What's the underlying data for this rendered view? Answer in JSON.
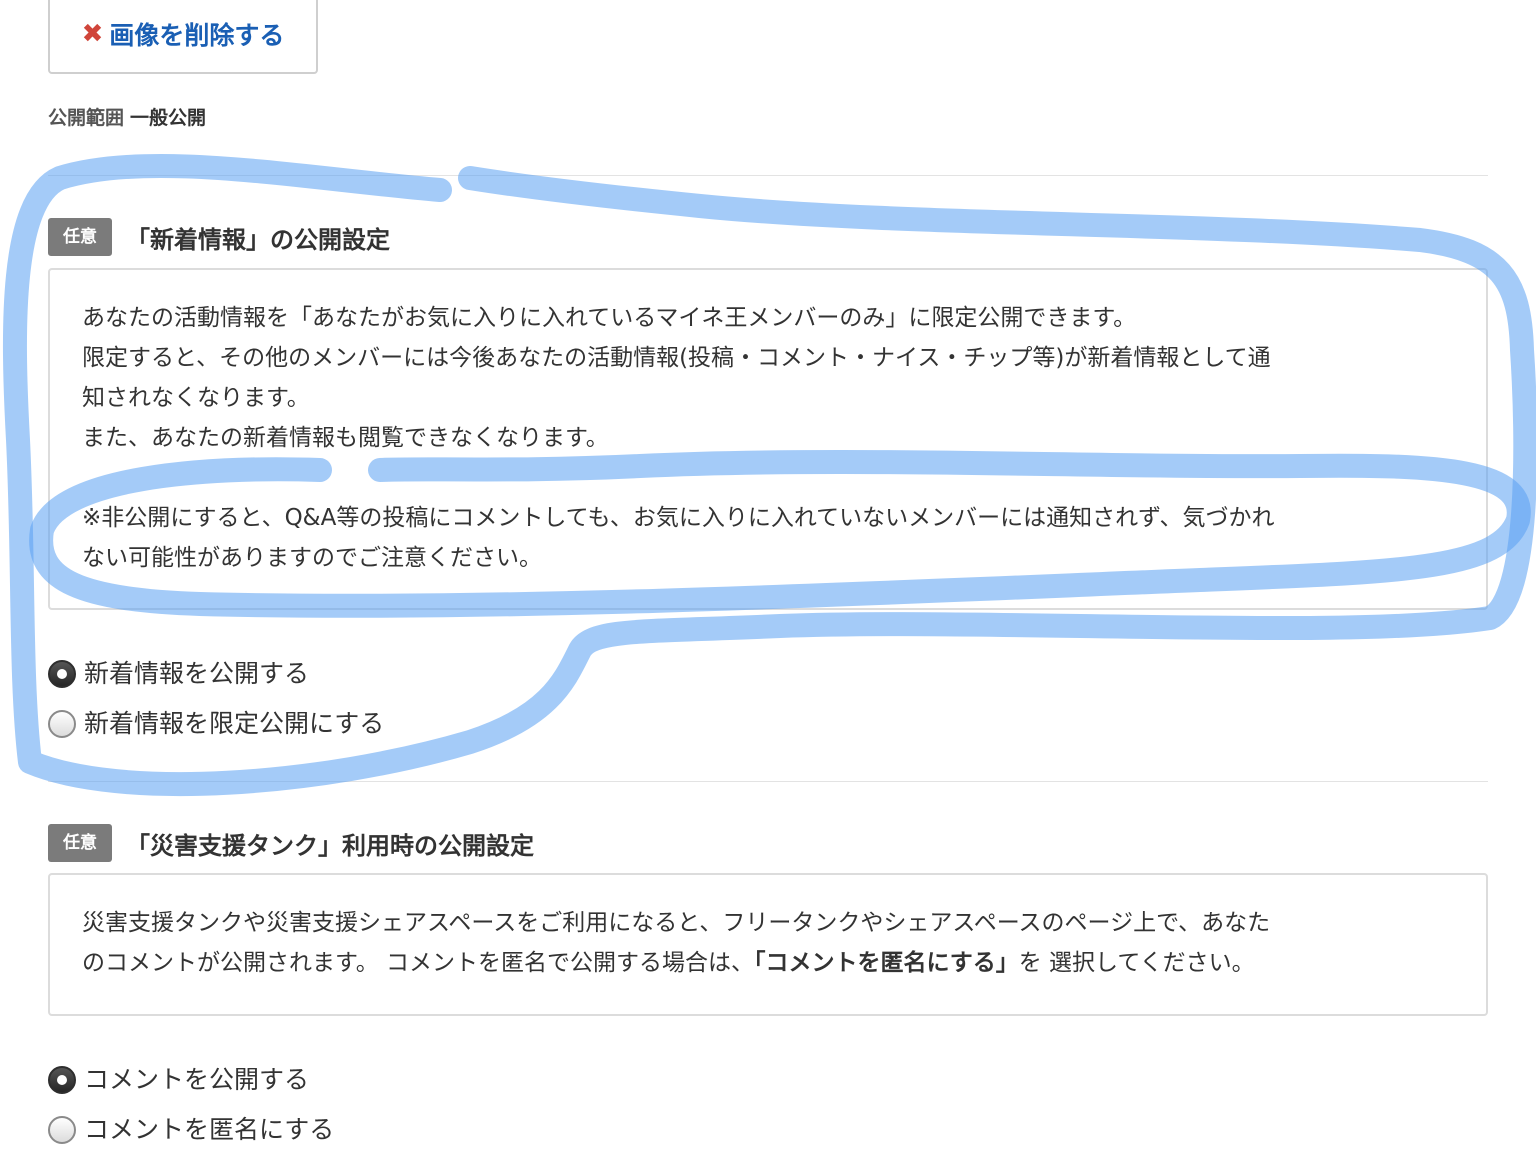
{
  "delete_image": {
    "icon": "close-icon",
    "label": "画像を削除する"
  },
  "visibility": {
    "label": "公開範囲",
    "value": "一般公開"
  },
  "news_section": {
    "badge": "任意",
    "title": "「新着情報」の公開設定",
    "lines": [
      "あなたの活動情報を「あなたがお気に入りに入れているマイネ王メンバーのみ」に限定公開できます。",
      "限定すると、その他のメンバーには今後あなたの活動情報(投稿・コメント・ナイス・チップ等)が新着情報として通",
      "知されなくなります。",
      "また、あなたの新着情報も閲覧できなくなります。",
      "※非公開にすると、Q&A等の投稿にコメントしても、お気に入りに入れていないメンバーには通知されず、気づかれ",
      "ない可能性がありますのでご注意ください。"
    ],
    "options": [
      {
        "label": "新着情報を公開する",
        "checked": true
      },
      {
        "label": "新着情報を限定公開にする",
        "checked": false
      }
    ]
  },
  "disaster_section": {
    "badge": "任意",
    "title": "「災害支援タンク」利用時の公開設定",
    "line1": "災害支援タンクや災害支援シェアスペースをご利用になると、フリータンクやシェアスペースのページ上で、あなた",
    "line2_prefix": "のコメントが公開されます。 コメントを匿名で公開する場合は、",
    "line2_emphasis": "「コメントを匿名にする」",
    "line2_suffix": "を 選択してください。",
    "options": [
      {
        "label": "コメントを公開する",
        "checked": true
      },
      {
        "label": "コメントを匿名にする",
        "checked": false
      }
    ]
  },
  "colors": {
    "accent": "#1a5fb4",
    "delete_icon": "#d0453a",
    "badge": "#7b7b7b",
    "annotation": "#5aa0f2"
  }
}
